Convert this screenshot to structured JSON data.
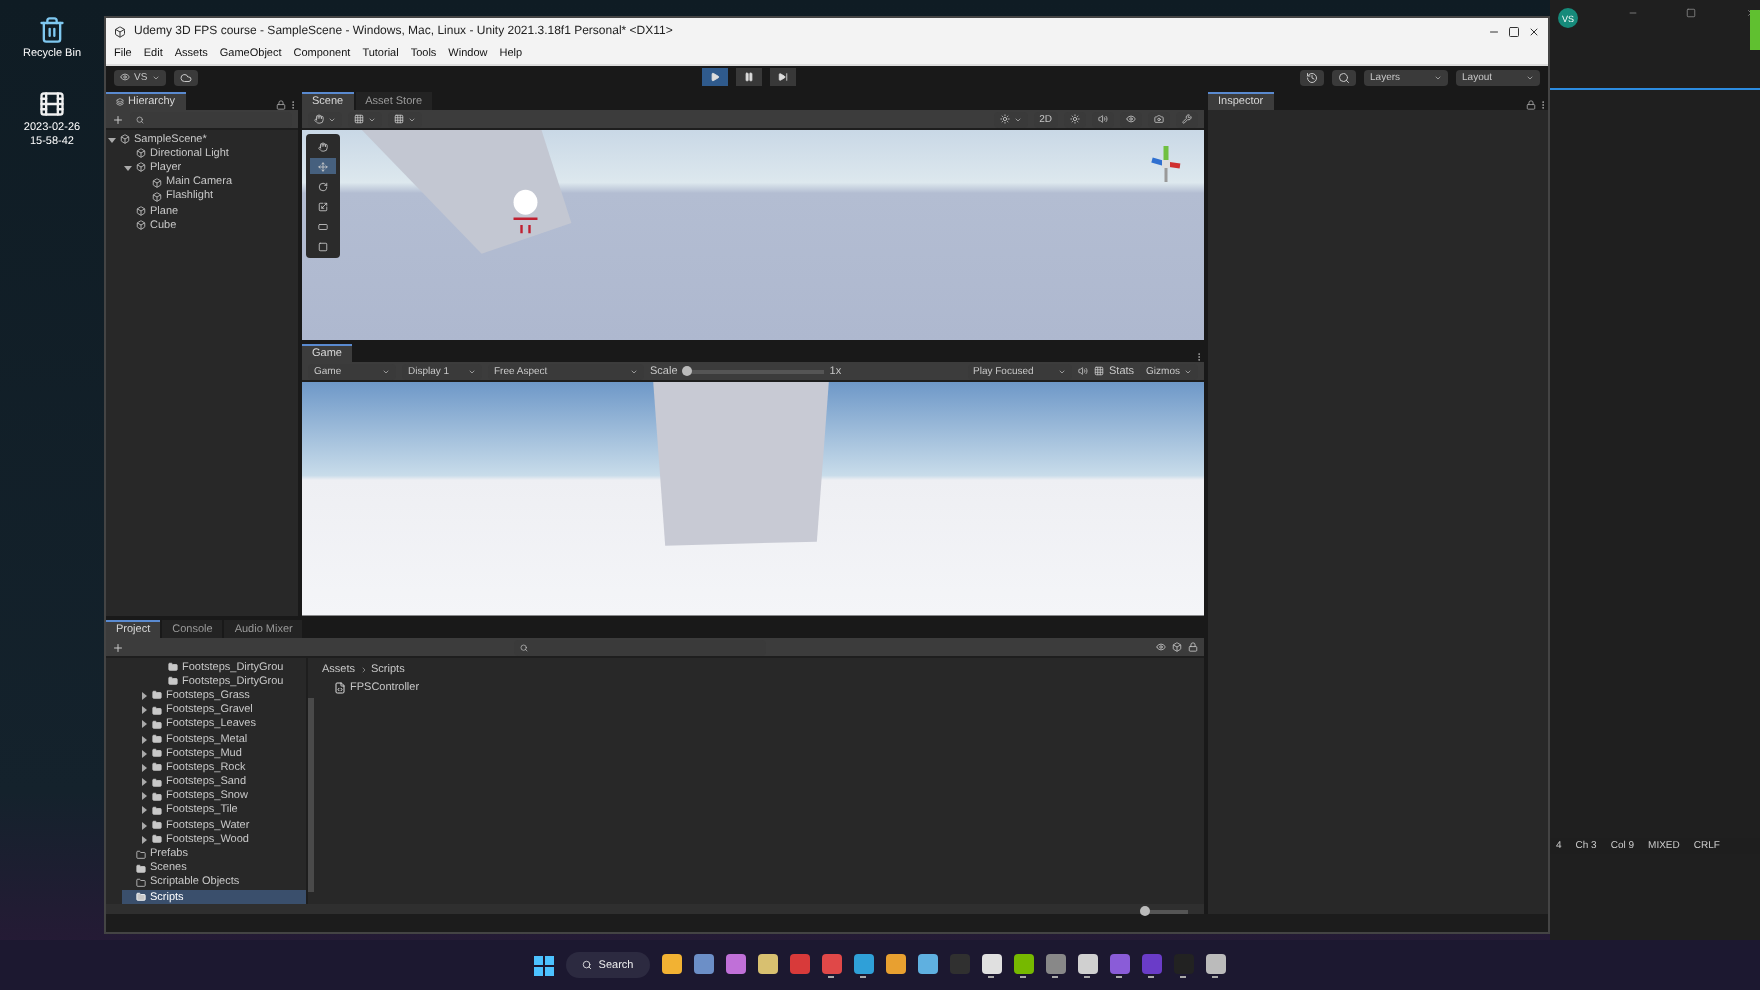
{
  "desktop": {
    "icons": [
      {
        "kind": "bin",
        "lines": [
          "Recycle Bin"
        ]
      },
      {
        "kind": "video",
        "lines": [
          "2023-02-26",
          "15-58-42"
        ]
      }
    ]
  },
  "window": {
    "title": "Udemy 3D FPS course - SampleScene - Windows, Mac, Linux - Unity 2021.3.18f1 Personal* <DX11>",
    "menu": [
      "File",
      "Edit",
      "Assets",
      "GameObject",
      "Component",
      "Tutorial",
      "Tools",
      "Window",
      "Help"
    ]
  },
  "toolbar": {
    "account": "VS",
    "playback": [
      {
        "kind": "play",
        "selected": true
      },
      {
        "kind": "pause",
        "selected": false
      },
      {
        "kind": "step",
        "selected": false
      }
    ],
    "layers": "Layers",
    "layout": "Layout"
  },
  "hierarchy": {
    "tab": "Hierarchy",
    "tree": [
      {
        "label": "SampleScene*",
        "kind": "scene",
        "expanded": true,
        "selected": false,
        "children": [
          {
            "label": "Directional Light",
            "kind": "object",
            "selected": false
          },
          {
            "label": "Player",
            "kind": "object",
            "expanded": true,
            "selected": false,
            "children": [
              {
                "label": "Main Camera",
                "kind": "object",
                "selected": false
              },
              {
                "label": "Flashlight",
                "kind": "object",
                "selected": false
              }
            ]
          },
          {
            "label": "Plane",
            "kind": "object",
            "selected": false
          },
          {
            "label": "Cube",
            "kind": "object",
            "selected": false
          }
        ]
      }
    ]
  },
  "scene": {
    "tabs": [
      {
        "label": "Scene",
        "selected": true
      },
      {
        "label": "Asset Store",
        "selected": false
      }
    ],
    "mode_2d": "2D"
  },
  "game": {
    "tab": "Game",
    "view": "Game",
    "display": "Display 1",
    "aspect": "Free Aspect",
    "scale_label": "Scale",
    "scale": {
      "level": 0.02
    },
    "scale_reading": "1x",
    "play_mode": "Play Focused",
    "stats": "Stats",
    "gizmos": "Gizmos"
  },
  "project": {
    "tabs": [
      {
        "label": "Project",
        "selected": true
      },
      {
        "label": "Console",
        "selected": false
      },
      {
        "label": "Audio Mixer",
        "selected": false
      }
    ],
    "tree": [
      {
        "children": [
          {
            "children": [
              {
                "label": "Footsteps_DirtyGrou",
                "kind": "folder",
                "selected": false
              },
              {
                "label": "Footsteps_DirtyGrou",
                "kind": "folder",
                "selected": false
              }
            ]
          },
          {
            "label": "Footsteps_Grass",
            "kind": "folder",
            "expanded": false,
            "selected": false
          },
          {
            "label": "Footsteps_Gravel",
            "kind": "folder",
            "expanded": false,
            "selected": false
          },
          {
            "label": "Footsteps_Leaves",
            "kind": "folder",
            "expanded": false,
            "selected": false
          },
          {
            "label": "Footsteps_Metal",
            "kind": "folder",
            "expanded": false,
            "selected": false
          },
          {
            "label": "Footsteps_Mud",
            "kind": "folder",
            "expanded": false,
            "selected": false
          },
          {
            "label": "Footsteps_Rock",
            "kind": "folder",
            "expanded": false,
            "selected": false
          },
          {
            "label": "Footsteps_Sand",
            "kind": "folder",
            "expanded": false,
            "selected": false
          },
          {
            "label": "Footsteps_Snow",
            "kind": "folder",
            "expanded": false,
            "selected": false
          },
          {
            "label": "Footsteps_Tile",
            "kind": "folder",
            "expanded": false,
            "selected": false
          },
          {
            "label": "Footsteps_Water",
            "kind": "folder",
            "expanded": false,
            "selected": false
          },
          {
            "label": "Footsteps_Wood",
            "kind": "folder",
            "expanded": false,
            "selected": false
          }
        ]
      },
      {
        "label": "Prefabs",
        "kind": "empty",
        "selected": false
      },
      {
        "label": "Scenes",
        "kind": "folder",
        "selected": false
      },
      {
        "label": "Scriptable Objects",
        "kind": "empty",
        "selected": false
      },
      {
        "label": "Scripts",
        "kind": "folder",
        "selected": true
      }
    ],
    "breadcrumb": [
      "Assets",
      "Scripts"
    ],
    "files": [
      {
        "name": "FPSController"
      }
    ],
    "zoom": {
      "level": 0.1
    }
  },
  "inspector": {
    "tab": "Inspector"
  },
  "editor": {
    "account": "VS",
    "status": [
      "4",
      "Ch 3",
      "Col 9",
      "MIXED",
      "CRLF"
    ]
  },
  "taskbar": {
    "search": "Search",
    "apps": [
      {
        "color": "#f2b233",
        "running": false
      },
      {
        "color": "#6c8fc7",
        "running": false
      },
      {
        "color": "#c070d8",
        "running": false
      },
      {
        "color": "#d8c070",
        "running": false
      },
      {
        "color": "#d83a3a",
        "running": false
      },
      {
        "color": "#e04848",
        "running": true
      },
      {
        "color": "#2fa0d8",
        "running": true
      },
      {
        "color": "#e8a030",
        "running": false
      },
      {
        "color": "#5fb0e0",
        "running": false
      },
      {
        "color": "#303030",
        "running": false
      },
      {
        "color": "#e0e0e0",
        "running": true
      },
      {
        "color": "#76b900",
        "running": true
      },
      {
        "color": "#888888",
        "running": true
      },
      {
        "color": "#d0d0d0",
        "running": true
      },
      {
        "color": "#8a5cd8",
        "running": true
      },
      {
        "color": "#6a3cc8",
        "running": true
      },
      {
        "color": "#222222",
        "running": true
      },
      {
        "color": "#bbbbbb",
        "running": true
      }
    ]
  }
}
